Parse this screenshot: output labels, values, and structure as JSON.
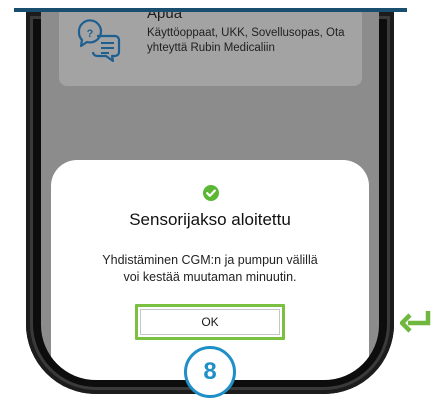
{
  "help": {
    "title": "Apua",
    "description": "Käyttöoppaat, UKK, Sovellusopas, Ota yhteyttä Rubin Medicaliin",
    "icon": "chat-help-icon"
  },
  "dialog": {
    "status_icon": "check-circle-icon",
    "title": "Sensorijakso aloitettu",
    "message_line1": "Yhdistäminen CGM:n ja pumpun välillä",
    "message_line2": "voi kestää muutaman minuutin.",
    "ok_label": "OK"
  },
  "step": {
    "number": "8"
  },
  "hint": {
    "icon": "enter-return-icon"
  },
  "colors": {
    "accent_green": "#7ac142",
    "check_green": "#5cb834",
    "step_blue": "#1e8fc7",
    "top_rule": "#1a4e6e",
    "overlay": "#8c8c8c"
  }
}
